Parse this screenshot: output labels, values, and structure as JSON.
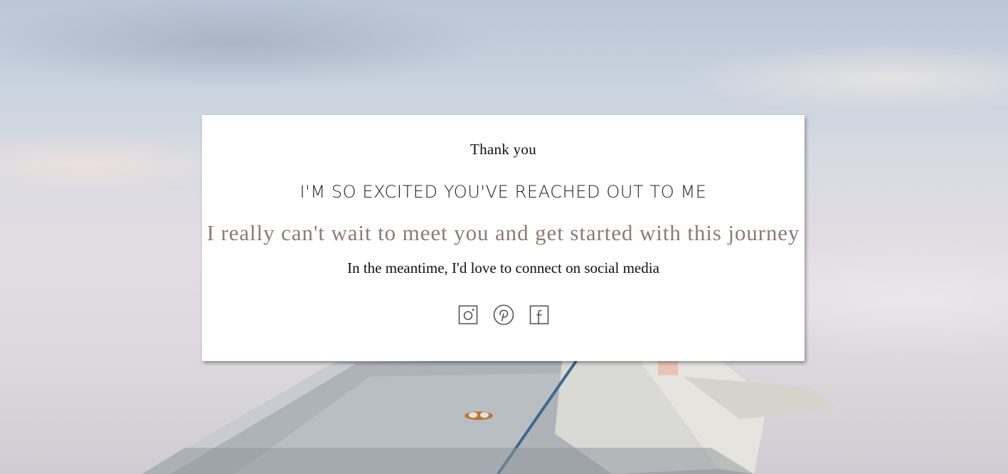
{
  "card": {
    "thank_you": "Thank you",
    "excited": "I'M SO EXCITED YOU'VE REACHED OUT TO ME",
    "journey": "I really can't wait to meet you and get started with this journey",
    "connect": "In the meantime, I'd love to connect on social media"
  },
  "socials": [
    {
      "icon": "instagram-icon"
    },
    {
      "icon": "pinterest-icon"
    },
    {
      "icon": "facebook-icon"
    }
  ],
  "colors": {
    "accent_text": "#8a7c74",
    "card_bg": "#ffffff",
    "icon_stroke": "#555555"
  }
}
